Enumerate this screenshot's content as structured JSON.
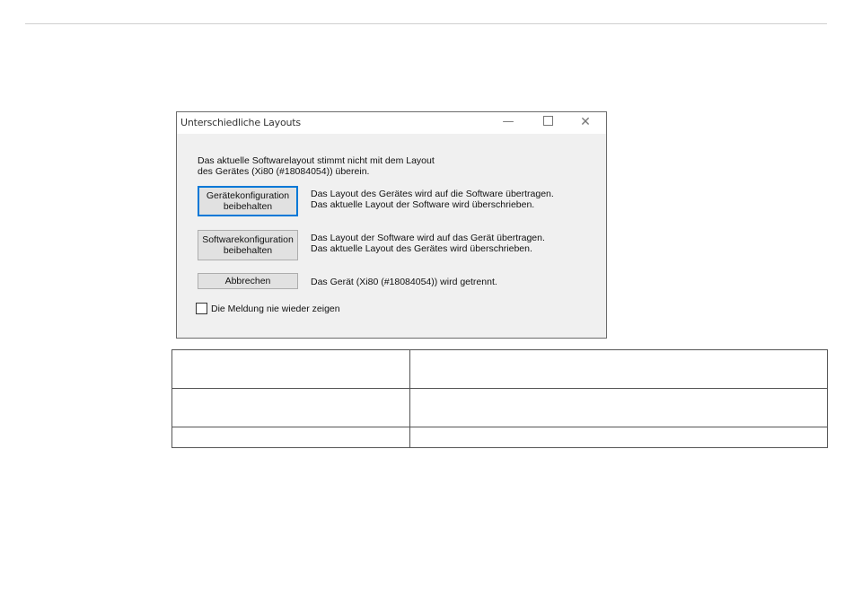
{
  "dialog": {
    "title": "Unterschiedliche Layouts",
    "window_controls": {
      "minimize": "—",
      "maximize_icon": "square-icon",
      "close": "✕"
    },
    "message_line1": "Das aktuelle Softwarelayout stimmt nicht mit dem Layout",
    "message_line2": "des Gerätes (Xi80  (#18084054)) überein.",
    "options": [
      {
        "button_line1": "Gerätekonfiguration",
        "button_line2": "beibehalten",
        "desc_line1": "Das Layout des Gerätes wird auf die Software übertragen.",
        "desc_line2": "Das aktuelle Layout der Software wird überschrieben."
      },
      {
        "button_line1": "Softwarekonfiguration",
        "button_line2": "beibehalten",
        "desc_line1": "Das Layout der Software wird auf das Gerät übertragen.",
        "desc_line2": "Das aktuelle Layout des Gerätes wird überschrieben."
      },
      {
        "button_line1": "Abbrechen",
        "desc_line1": "Das Gerät (Xi80  (#18084054)) wird getrennt."
      }
    ],
    "checkbox_label": "Die Meldung nie wieder zeigen",
    "checkbox_checked": false,
    "accent_color": "#0078d7"
  },
  "table": {
    "rows": [
      [
        "",
        ""
      ],
      [
        "",
        ""
      ],
      [
        "",
        ""
      ]
    ]
  }
}
